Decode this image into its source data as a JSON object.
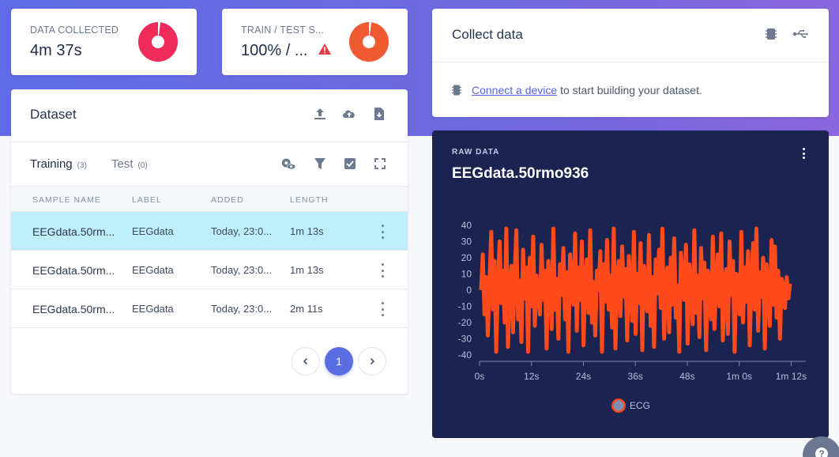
{
  "stats": [
    {
      "label": "DATA COLLECTED",
      "value": "4m 37s",
      "color": "#ee2b5b",
      "fraction": 0.02
    },
    {
      "label": "TRAIN / TEST S...",
      "value": "100% / ...",
      "color": "#f05a32",
      "fraction": 0.02,
      "warning": true
    }
  ],
  "dataset": {
    "title": "Dataset",
    "tabs": [
      {
        "label": "Training",
        "count": "(3)",
        "active": true
      },
      {
        "label": "Test",
        "count": "(0)",
        "active": false
      }
    ],
    "columns": [
      "SAMPLE NAME",
      "LABEL",
      "ADDED",
      "LENGTH"
    ],
    "rows": [
      {
        "name": "EEGdata.50rm...",
        "label": "EEGdata",
        "added": "Today, 23:0...",
        "length": "1m 13s",
        "selected": true
      },
      {
        "name": "EEGdata.50rm...",
        "label": "EEGdata",
        "added": "Today, 23:0...",
        "length": "1m 13s",
        "selected": false
      },
      {
        "name": "EEGdata.50rm...",
        "label": "EEGdata",
        "added": "Today, 23:0...",
        "length": "2m 11s",
        "selected": false
      }
    ],
    "current_page": "1"
  },
  "collect": {
    "title": "Collect data",
    "link_text": "Connect a device",
    "rest_text": " to start building your dataset."
  },
  "raw": {
    "label": "RAW DATA",
    "title": "EEGdata.50rmo936"
  },
  "help": {
    "symbol": "?"
  },
  "colors": {
    "accent": "#5b6ee1",
    "signal": "#ff4a1c",
    "panel": "#1b2350"
  },
  "chart_data": {
    "type": "line",
    "title": "",
    "xlabel": "",
    "ylabel": "",
    "ylim": [
      -40,
      40
    ],
    "xlim_seconds": [
      0,
      73
    ],
    "yticks": [
      "40",
      "30",
      "20",
      "10",
      "0",
      "-10",
      "-20",
      "-30",
      "-40"
    ],
    "xticks": [
      "0s",
      "12s",
      "24s",
      "36s",
      "48s",
      "1m 0s",
      "1m 12s"
    ],
    "series": [
      {
        "name": "ECG",
        "color": "#ff4a1c",
        "values": [
          0,
          22,
          -15,
          8,
          -28,
          5,
          36,
          -12,
          18,
          -38,
          4,
          30,
          -8,
          12,
          -20,
          38,
          -35,
          2,
          15,
          -26,
          10,
          37,
          -18,
          6,
          -32,
          25,
          -5,
          14,
          -38,
          20,
          -10,
          33,
          -22,
          9,
          0,
          -15,
          28,
          -6,
          12,
          -36,
          18,
          4,
          -24,
          38,
          -12,
          7,
          -30,
          16,
          -3,
          26,
          -18,
          11,
          -38,
          22,
          3,
          -9,
          35,
          -25,
          14,
          -6,
          30,
          -34,
          8,
          19,
          -14,
          37,
          -20,
          5,
          -28,
          12,
          0,
          24,
          -38,
          16,
          -7,
          31,
          -12,
          9,
          -23,
          38,
          -36,
          6,
          18,
          -16,
          27,
          -4,
          13,
          -31,
          21,
          2,
          -19,
          36,
          -27,
          10,
          -8,
          29,
          -37,
          15,
          4,
          -13,
          34,
          -22,
          8,
          -35,
          19,
          -2,
          25,
          -11,
          38,
          -30,
          7,
          14,
          -26,
          20,
          -9,
          32,
          -17,
          3,
          -38,
          23,
          11,
          -6,
          28,
          -33,
          16,
          1,
          -21,
          37,
          -14,
          9,
          -29,
          26,
          -5,
          17,
          -37,
          12,
          0,
          -18,
          33,
          -24,
          6,
          22,
          -10,
          35,
          -31,
          4,
          13,
          -27,
          30,
          -3,
          18,
          -38,
          10,
          8,
          -15,
          36,
          -20,
          14,
          -7,
          24,
          -34,
          5,
          29,
          -12,
          38,
          -25,
          11,
          -4,
          20,
          -36,
          16,
          2,
          -22,
          31,
          -9,
          27,
          -17,
          12,
          -30,
          7,
          3,
          -11,
          8,
          -5,
          4
        ]
      }
    ]
  }
}
